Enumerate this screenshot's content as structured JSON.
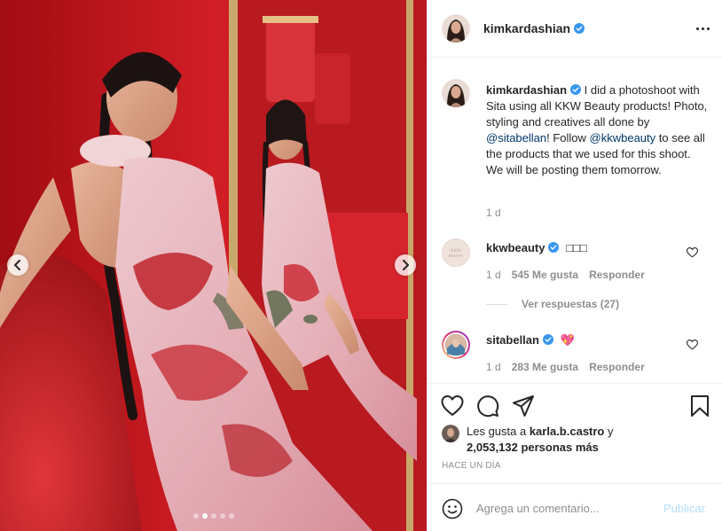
{
  "post": {
    "author": "kimkardashian",
    "verified": true,
    "more_icon": "more-horizontal-icon"
  },
  "media": {
    "prev_icon": "chevron-left-icon",
    "next_icon": "chevron-right-icon",
    "dots_total": 5,
    "dots_active_index": 1
  },
  "caption": {
    "author": "kimkardashian",
    "text_1": "I did a photoshoot with Sita using all KKW Beauty products! Photo, styling and creatives all done by ",
    "mention_1": "@sitabellan",
    "text_2": "! Follow ",
    "mention_2": "@kkwbeauty",
    "text_3": " to see all the products that we used for this shoot. We will be posting them tomorrow.",
    "time": "1 d"
  },
  "comments": [
    {
      "author": "kkwbeauty",
      "verified": true,
      "text": "□□□",
      "time": "1 d",
      "likes": "545 Me gusta",
      "reply_label": "Responder",
      "view_replies": "Ver respuestas (27)"
    },
    {
      "author": "sitabellan",
      "verified": true,
      "text": "💖",
      "time": "1 d",
      "likes": "283 Me gusta",
      "reply_label": "Responder"
    }
  ],
  "actions": {
    "icons": [
      "heart-icon",
      "comment-icon",
      "share-icon",
      "bookmark-icon"
    ]
  },
  "likes": {
    "prefix": "Les gusta a ",
    "user": "karla.b.castro",
    "middle": " y",
    "count": "2,053,132 personas más"
  },
  "timestamp": "HACE UN DÍA",
  "comment_box": {
    "placeholder": "Agrega un comentario...",
    "publish_label": "Publicar"
  },
  "colors": {
    "link": "#00376b",
    "verified": "#3897f0",
    "muted": "#8e8e8e",
    "publish_disabled": "#b2dffc",
    "scene_red": "#c2151c"
  }
}
